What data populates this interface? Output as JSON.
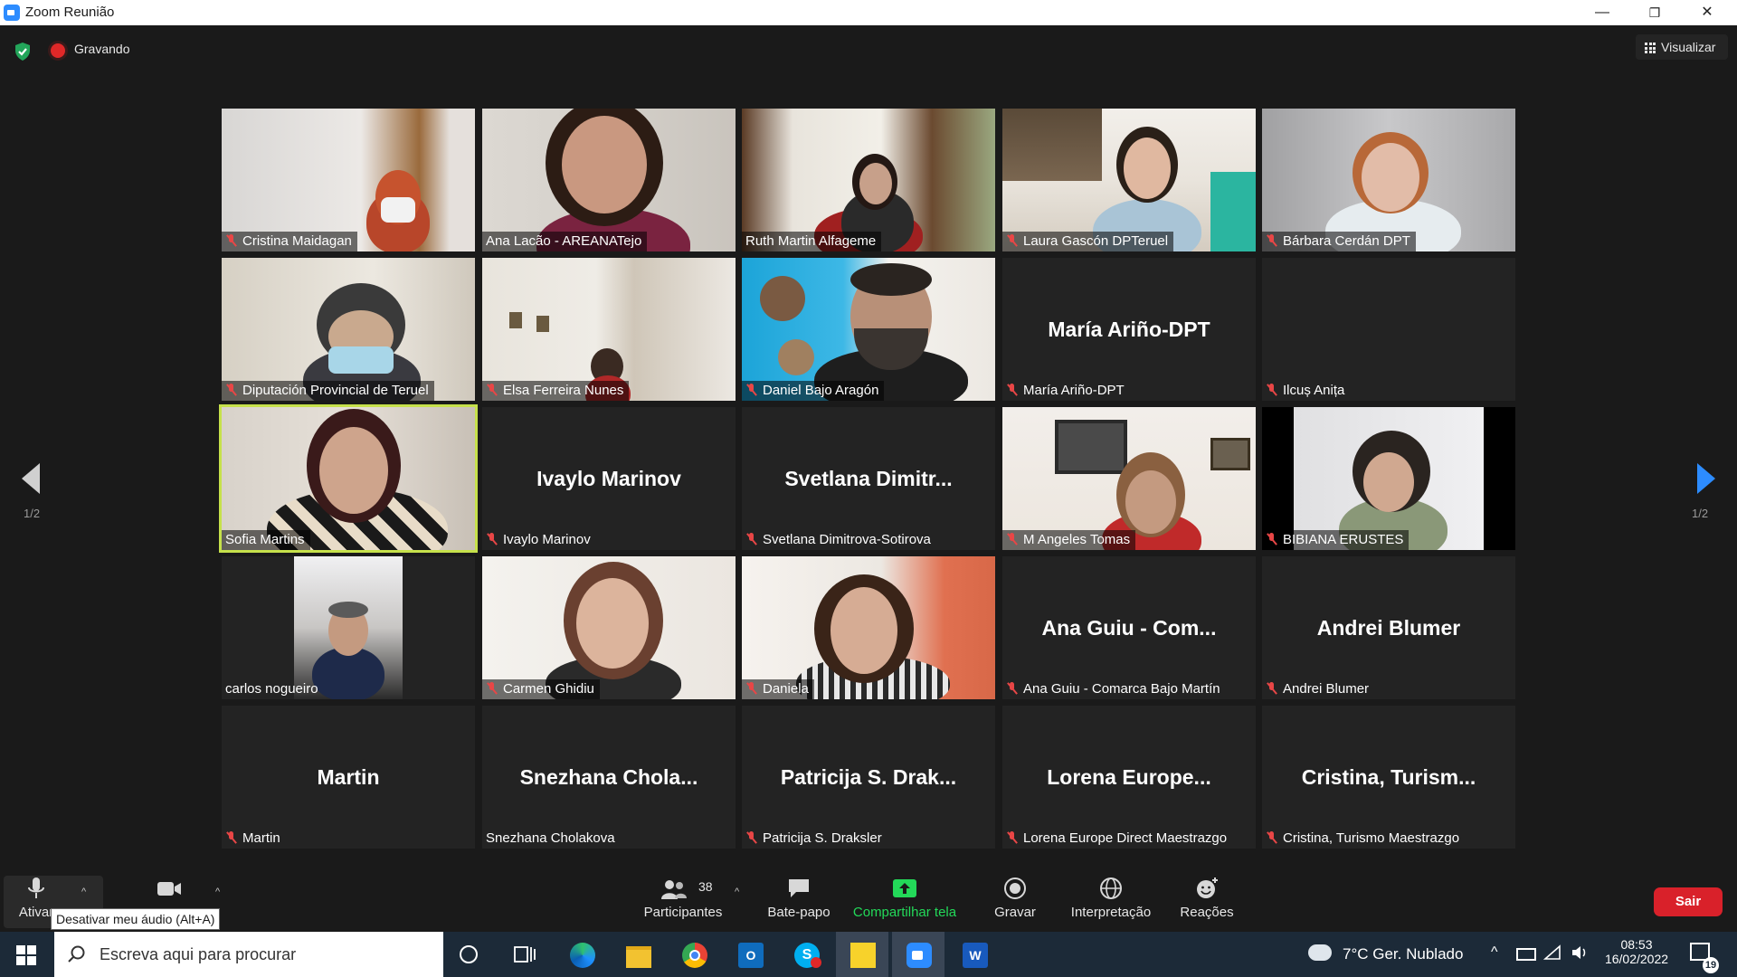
{
  "window": {
    "title": "Zoom Reunião",
    "minimize": "—",
    "restore": "❐",
    "close": "✕"
  },
  "top": {
    "recording_label": "Gravando",
    "view_label": "Visualizar"
  },
  "tiles": [
    {
      "name": "Cristina Maidagan",
      "muted": true
    },
    {
      "name": "Ana Lacão - AREANATejo",
      "muted": false
    },
    {
      "name": "Ruth Martin Alfageme",
      "muted": false
    },
    {
      "name": "Laura Gascón DPTeruel",
      "muted": true
    },
    {
      "name": "Bárbara Cerdán DPT",
      "muted": true
    },
    {
      "name": "Diputación Provincial de Teruel",
      "muted": true
    },
    {
      "name": "Elsa Ferreira Nunes",
      "muted": true
    },
    {
      "name": "Daniel Bajo Aragón",
      "muted": true
    },
    {
      "name": "María Ariño-DPT",
      "big_name": "María Ariño-DPT",
      "muted": true
    },
    {
      "name": "Ilcuș Anița",
      "big_name": "",
      "muted": true
    },
    {
      "name": "Sofia Martins",
      "muted": false,
      "active": true
    },
    {
      "name": "Ivaylo Marinov",
      "big_name": "Ivaylo Marinov",
      "muted": true
    },
    {
      "name": "Svetlana Dimitrova-Sotirova",
      "big_name": "Svetlana  Dimitr...",
      "muted": true
    },
    {
      "name": "M Angeles Tomas",
      "muted": true
    },
    {
      "name": "BIBIANA ERUSTES",
      "muted": true
    },
    {
      "name": "carlos nogueiro",
      "muted": false
    },
    {
      "name": "Carmen Ghidiu",
      "muted": true
    },
    {
      "name": "Daniela",
      "muted": true
    },
    {
      "name": "Ana Guiu - Comarca Bajo Martín",
      "big_name": "Ana Guiu - Com...",
      "muted": true
    },
    {
      "name": "Andrei Blumer",
      "big_name": "Andrei Blumer",
      "muted": true
    },
    {
      "name": "Martin",
      "big_name": "Martin",
      "muted": true
    },
    {
      "name": "Snezhana Cholakova",
      "big_name": "Snezhana  Chola...",
      "muted": false
    },
    {
      "name": "Patricija S. Draksler",
      "big_name": "Patricija  S.  Drak...",
      "muted": true
    },
    {
      "name": "Lorena Europe Direct Maestrazgo",
      "big_name": "Lorena  Europe...",
      "muted": true
    },
    {
      "name": "Cristina, Turismo Maestrazgo",
      "big_name": "Cristina,  Turism...",
      "muted": true
    }
  ],
  "pager": {
    "left": "1/2",
    "right": "1/2"
  },
  "toolbar": {
    "audio_label": "Ativar",
    "audio_tooltip": "Desativar meu áudio (Alt+A)",
    "participants_label": "Participantes",
    "participants_count": "38",
    "chat_label": "Bate-papo",
    "share_label": "Compartilhar tela",
    "record_label": "Gravar",
    "interpretation_label": "Interpretação",
    "reactions_label": "Reações",
    "exit_label": "Sair",
    "share_color": "#23d959",
    "exit_color": "#d9212a"
  },
  "taskbar": {
    "search_placeholder": "Escreva aqui para procurar",
    "weather": "7°C  Ger. Nublado",
    "time": "08:53",
    "date": "16/02/2022",
    "notifications": "19"
  }
}
